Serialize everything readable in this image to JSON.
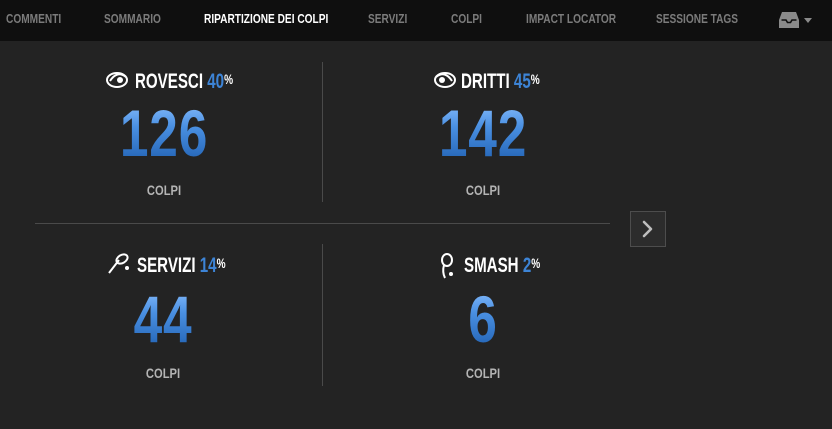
{
  "nav": {
    "items": [
      {
        "label": "COMMENTI"
      },
      {
        "label": "SOMMARIO"
      },
      {
        "label": "RIPARTIZIONE DEI COLPI",
        "active": true
      },
      {
        "label": "SERVIZI"
      },
      {
        "label": "COLPI"
      },
      {
        "label": "IMPACT LOCATOR"
      },
      {
        "label": "SESSIONE TAGS"
      }
    ],
    "tray_icon": "inbox-tray-icon",
    "tray_dropdown_icon": "caret-down-icon"
  },
  "stats": [
    {
      "title": "ROVESCI",
      "percent": "40",
      "percent_sign": "%",
      "value": "126",
      "unit": "COLPI",
      "icon": "backhand-stroke-icon"
    },
    {
      "title": "DRITTI",
      "percent": "45",
      "percent_sign": "%",
      "value": "142",
      "unit": "COLPI",
      "icon": "forehand-stroke-icon"
    },
    {
      "title": "SERVIZI",
      "percent": "14",
      "percent_sign": "%",
      "value": "44",
      "unit": "COLPI",
      "icon": "serve-stroke-icon"
    },
    {
      "title": "SMASH",
      "percent": "2",
      "percent_sign": "%",
      "value": "6",
      "unit": "COLPI",
      "icon": "smash-stroke-icon"
    }
  ],
  "next_button": {
    "icon": "chevron-right-icon"
  },
  "colors": {
    "accent": "#3d84d6",
    "background": "#232323",
    "navbar": "#0f0f0f"
  }
}
